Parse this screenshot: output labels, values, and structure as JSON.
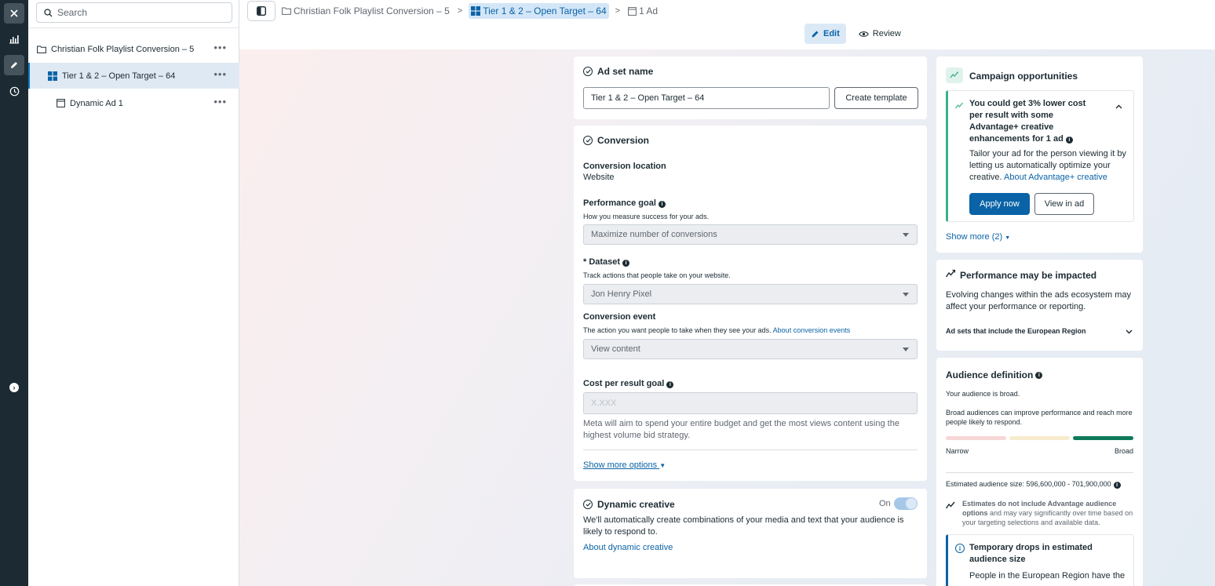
{
  "tree": {
    "search_placeholder": "Search",
    "items": [
      {
        "label": "Christian Folk Playlist Conversion – 5",
        "more": "•••"
      },
      {
        "label": "Tier 1 & 2 – Open Target – 64",
        "more": "•••"
      },
      {
        "label": "Dynamic Ad 1",
        "more": "•••"
      }
    ]
  },
  "topbar": {
    "breadcrumbs": [
      "Christian Folk Playlist Conversion – 5",
      "Tier 1 & 2 – Open Target – 64",
      "1 Ad"
    ],
    "modes": {
      "edit": "Edit",
      "review": "Review"
    }
  },
  "adset": {
    "title": "Ad set name",
    "name_value": "Tier 1 & 2 – Open Target – 64",
    "create_template": "Create template"
  },
  "conversion": {
    "title": "Conversion",
    "location_label": "Conversion location",
    "location_value": "Website",
    "perf_goal_label": "Performance goal",
    "perf_goal_desc": "How you measure success for your ads.",
    "perf_goal_value": "Maximize number of conversions",
    "dataset_label": "* Dataset",
    "dataset_desc": "Track actions that people take on your website.",
    "dataset_value": "Jon Henry Pixel",
    "event_label": "Conversion event",
    "event_desc": "The action you want people to take when they see your ads.",
    "event_link": "About conversion events",
    "event_value": "View content",
    "cost_label": "Cost per result goal",
    "cost_placeholder": "X.XXX",
    "cost_desc": "Meta will aim to spend your entire budget and get the most views content using the highest volume bid strategy.",
    "show_more": "Show more options"
  },
  "dynamic": {
    "title": "Dynamic creative",
    "toggle_label": "On",
    "toggle_on": true,
    "desc": "We'll automatically create combinations of your media and text that your audience is likely to respond to.",
    "link": "About dynamic creative"
  },
  "opportunities": {
    "title": "Campaign opportunities",
    "headline": "You could get 3% lower cost per result with some Advantage+ creative enhancements for 1 ad",
    "body": "Tailor your ad for the person viewing it by letting us automatically optimize your creative.",
    "body_link": "About Advantage+ creative",
    "apply": "Apply now",
    "view": "View in ad",
    "show_more": "Show more (2)"
  },
  "performance": {
    "title": "Performance may be impacted",
    "body": "Evolving changes within the ads ecosystem may affect your performance or reporting.",
    "accordion": "Ad sets that include the European Region"
  },
  "audience": {
    "title": "Audience definition",
    "status": "Your audience is broad.",
    "desc": "Broad audiences can improve performance and reach more people likely to respond.",
    "narrow": "Narrow",
    "broad": "Broad",
    "estimated": "Estimated audience size: 596,600,000 - 701,900,000",
    "note_bold": "Estimates do not include Advantage audience options",
    "note_rest": " and may vary significantly over time based on your targeting selections and available data.",
    "drops_title": "Temporary drops in estimated audience size",
    "drops_body": "People in the European Region have the"
  },
  "colors": {
    "accent": "#0a63a6",
    "rail": "#1c2b33",
    "selected_row": "#dfe9f3",
    "gauge_broad": "#0f7a5a",
    "opportunity_bar": "#3ab08a"
  }
}
